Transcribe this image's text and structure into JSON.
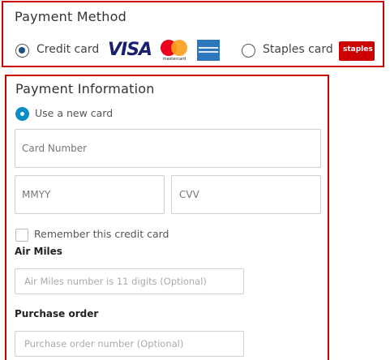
{
  "payment_method": {
    "title": "Payment Method",
    "options": [
      {
        "label": "Credit card",
        "selected": true
      },
      {
        "label": "Staples card",
        "selected": false
      }
    ],
    "card_logos": {
      "visa": "VISA",
      "mastercard": "mastercard",
      "amex": "AMERICAN EXPRESS",
      "staples": "staples"
    }
  },
  "payment_info": {
    "title": "Payment Information",
    "use_new_card": "Use a new card",
    "card_number_placeholder": "Card Number",
    "expiry_placeholder": "MMYY",
    "cvv_placeholder": "CVV",
    "remember_card": "Remember this credit card",
    "air_miles_label": "Air Miles",
    "air_miles_placeholder": "Air Miles number is 11 digits (Optional)",
    "purchase_order_label": "Purchase order",
    "purchase_order_placeholder": "Purchase order number (Optional)"
  },
  "colors": {
    "highlight_border": "#cc0000",
    "radio_selected": "#1f4f82",
    "radio_active": "#0a8cc4",
    "visa_blue": "#1a1f71",
    "mastercard_red": "#eb001b",
    "mastercard_orange": "#f79e1b",
    "amex_blue": "#2e77bc",
    "staples_red": "#cc0000"
  }
}
